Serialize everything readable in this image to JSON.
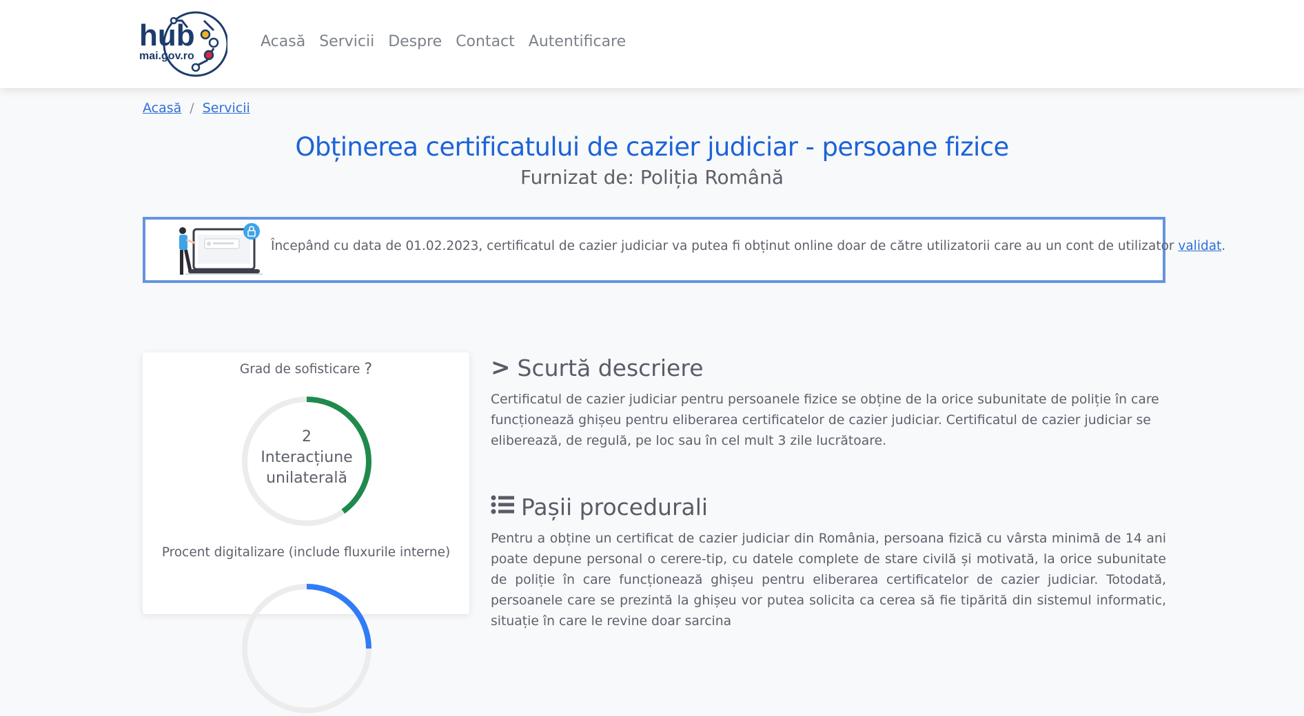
{
  "brand": {
    "logo_word": "hub",
    "logo_domain": "mai.gov.ro"
  },
  "nav": {
    "items": [
      "Acasă",
      "Servicii",
      "Despre",
      "Contact",
      "Autentificare"
    ]
  },
  "breadcrumb": {
    "home": "Acasă",
    "sep": "/",
    "current": "Servicii"
  },
  "page": {
    "title": "Obținerea certificatului de cazier judiciar - persoane fizice",
    "provider": "Furnizat de:  Poliția  Română"
  },
  "banner": {
    "text": "Începând cu data de 01.02.2023, certificatul de cazier judiciar va putea fi obținut online doar de către utilizatorii care au un cont de utilizator ",
    "link": "validat",
    "end": "."
  },
  "sidebar": {
    "sophistication_label": "Grad de sofisticare",
    "help_icon": "?",
    "sophistication_value": "2",
    "sophistication_line1": "Interacțiune",
    "sophistication_line2": "unilaterală",
    "sophistication_fraction": 0.4,
    "digitalization_label": "Procent digitalizare (include fluxurile interne)",
    "digitalization_fraction": 0.25
  },
  "colors": {
    "accent": "#1c63d7",
    "gauge_green": "#1f8a4c",
    "gauge_blue": "#2f7cf6",
    "banner_border": "#6594e0"
  },
  "sections": {
    "short_title": "Scurtă descriere",
    "short_icon": "chevron-right-icon",
    "short_text": "Certificatul de cazier judiciar pentru persoanele fizice se obține de la orice subunitate de poliție în care funcționează ghișeu pentru eliberarea certificatelor de cazier judiciar. Certificatul de cazier judiciar se eliberează, de regulă, pe loc sau în cel mult 3 zile lucrătoare.",
    "steps_title": "Pașii procedurali",
    "steps_icon": "list-icon",
    "steps_text": "Pentru a obține un certificat de cazier judiciar din  România, persoana fizică cu vârsta minimă de 14 ani poate depune personal o cerere-tip, cu datele complete de stare civilă și motivată, la orice subunitate de poliție în care funcționează ghișeu pentru eliberarea certificatelor de cazier judiciar. Totodată, persoanele care se prezintă la ghișeu vor putea solicita ca cerea să fie tipărită din sistemul informatic, situație în care le revine doar sarcina"
  }
}
